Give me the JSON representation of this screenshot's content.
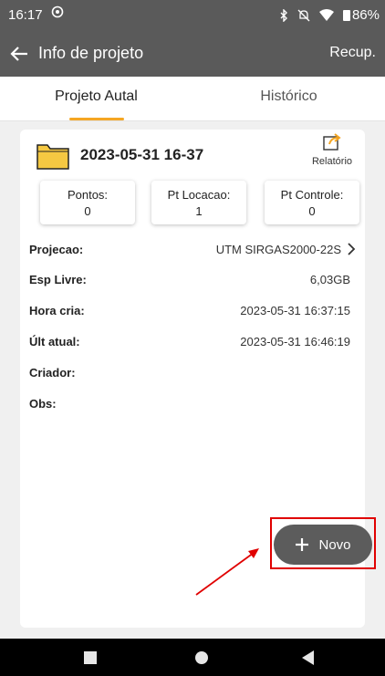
{
  "status_bar": {
    "time": "16:17",
    "battery": "86%"
  },
  "app_bar": {
    "title": "Info de projeto",
    "action": "Recup."
  },
  "tabs": [
    {
      "label": "Projeto Autal"
    },
    {
      "label": "Histórico"
    }
  ],
  "project": {
    "name": "2023-05-31 16-37",
    "report_label": "Relatório"
  },
  "stats": [
    {
      "label": "Pontos:",
      "value": "0"
    },
    {
      "label": "Pt Locacao:",
      "value": "1"
    },
    {
      "label": "Pt Controle:",
      "value": "0"
    }
  ],
  "details": [
    {
      "key": "Projecao:",
      "value": "UTM SIRGAS2000-22S"
    },
    {
      "key": "Esp Livre:",
      "value": "6,03GB"
    },
    {
      "key": "Hora cria:",
      "value": "2023-05-31 16:37:15"
    },
    {
      "key": "Últ atual:",
      "value": "2023-05-31 16:46:19"
    },
    {
      "key": "Criador:",
      "value": ""
    },
    {
      "key": "Obs:",
      "value": ""
    }
  ],
  "fab": {
    "label": "Novo"
  },
  "colors": {
    "bar": "#5a5a5a",
    "accent": "#f5a623",
    "folder": "#f5c842",
    "annotation": "#e00000"
  }
}
